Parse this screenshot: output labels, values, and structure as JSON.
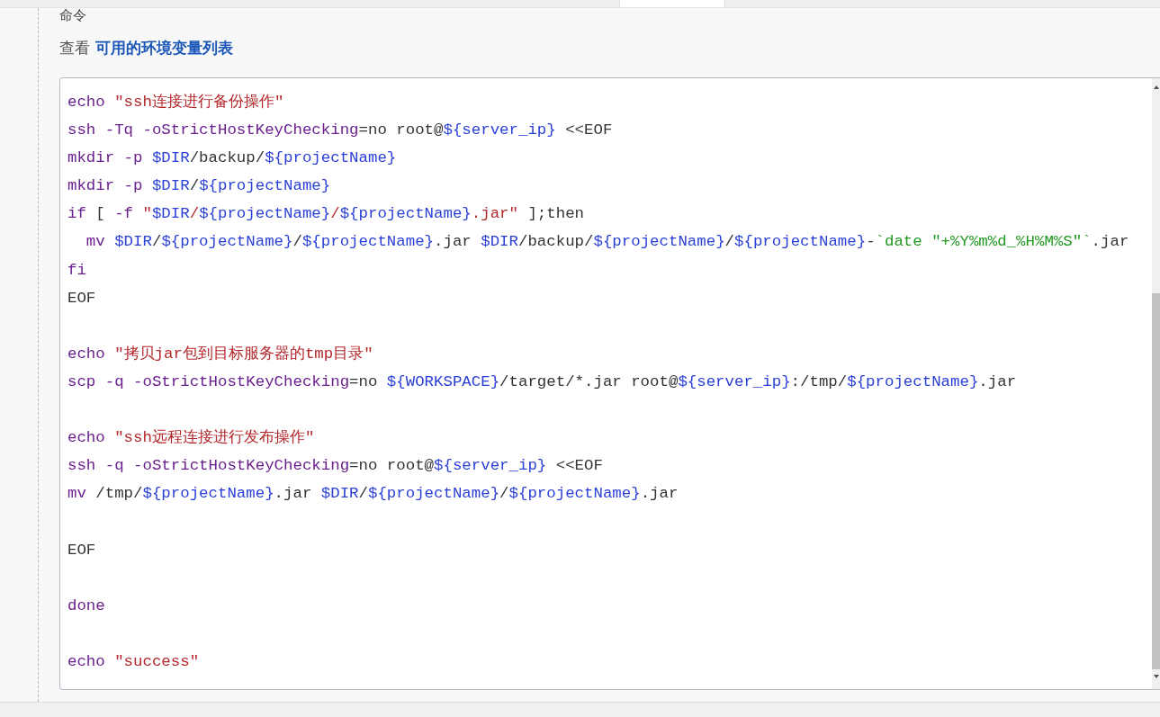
{
  "section_label": "命令",
  "hint": {
    "prefix": "查看",
    "link": "可用的环境变量列表"
  },
  "editor": {
    "lines": [
      {
        "kind": "code",
        "tokens": [
          {
            "kind": "kw",
            "t": "echo "
          },
          {
            "kind": "str",
            "t": "\"ssh连接进行备份操作\""
          }
        ]
      },
      {
        "kind": "code",
        "tokens": [
          {
            "kind": "kw",
            "t": "ssh -Tq -oStrictHostKeyChecking"
          },
          {
            "kind": "plain",
            "t": "=no root@"
          },
          {
            "kind": "var",
            "t": "${server_ip}"
          },
          {
            "kind": "plain",
            "t": " <<EOF"
          }
        ]
      },
      {
        "kind": "code",
        "tokens": [
          {
            "kind": "kw",
            "t": "mkdir -p "
          },
          {
            "kind": "var",
            "t": "$DIR"
          },
          {
            "kind": "plain",
            "t": "/backup/"
          },
          {
            "kind": "var",
            "t": "${projectName}"
          }
        ]
      },
      {
        "kind": "code",
        "tokens": [
          {
            "kind": "kw",
            "t": "mkdir -p "
          },
          {
            "kind": "var",
            "t": "$DIR"
          },
          {
            "kind": "plain",
            "t": "/"
          },
          {
            "kind": "var",
            "t": "${projectName}"
          }
        ]
      },
      {
        "kind": "code",
        "tokens": [
          {
            "kind": "kw",
            "t": "if"
          },
          {
            "kind": "plain",
            "t": " [ "
          },
          {
            "kind": "kw",
            "t": "-f "
          },
          {
            "kind": "str",
            "t": "\""
          },
          {
            "kind": "var",
            "t": "$DIR"
          },
          {
            "kind": "str",
            "t": "/"
          },
          {
            "kind": "var",
            "t": "${projectName}"
          },
          {
            "kind": "str",
            "t": "/"
          },
          {
            "kind": "var",
            "t": "${projectName}"
          },
          {
            "kind": "str",
            "t": ".jar\""
          },
          {
            "kind": "plain",
            "t": " ];then"
          }
        ]
      },
      {
        "kind": "code",
        "tokens": [
          {
            "kind": "kw",
            "t": "  mv "
          },
          {
            "kind": "var",
            "t": "$DIR"
          },
          {
            "kind": "plain",
            "t": "/"
          },
          {
            "kind": "var",
            "t": "${projectName}"
          },
          {
            "kind": "plain",
            "t": "/"
          },
          {
            "kind": "var",
            "t": "${projectName}"
          },
          {
            "kind": "plain",
            "t": ".jar "
          },
          {
            "kind": "var",
            "t": "$DIR"
          },
          {
            "kind": "plain",
            "t": "/backup/"
          },
          {
            "kind": "var",
            "t": "${projectName}"
          },
          {
            "kind": "plain",
            "t": "/"
          },
          {
            "kind": "var",
            "t": "${projectName}"
          },
          {
            "kind": "plain",
            "t": "-"
          },
          {
            "kind": "sub",
            "t": "`date \"+%Y%m%d_%H%M%S\"`"
          },
          {
            "kind": "plain",
            "t": ".jar"
          }
        ]
      },
      {
        "kind": "code",
        "tokens": [
          {
            "kind": "kw",
            "t": "fi"
          }
        ]
      },
      {
        "kind": "code",
        "tokens": [
          {
            "kind": "plain",
            "t": "EOF"
          }
        ]
      },
      {
        "kind": "blank"
      },
      {
        "kind": "code",
        "tokens": [
          {
            "kind": "kw",
            "t": "echo "
          },
          {
            "kind": "str",
            "t": "\"拷贝jar包到目标服务器的tmp目录\""
          }
        ]
      },
      {
        "kind": "code",
        "tokens": [
          {
            "kind": "kw",
            "t": "scp -q -oStrictHostKeyChecking"
          },
          {
            "kind": "plain",
            "t": "=no "
          },
          {
            "kind": "var",
            "t": "${WORKSPACE}"
          },
          {
            "kind": "plain",
            "t": "/target/*.jar root@"
          },
          {
            "kind": "var",
            "t": "${server_ip}"
          },
          {
            "kind": "plain",
            "t": ":/tmp/"
          },
          {
            "kind": "var",
            "t": "${projectName}"
          },
          {
            "kind": "plain",
            "t": ".jar"
          }
        ]
      },
      {
        "kind": "blank"
      },
      {
        "kind": "code",
        "tokens": [
          {
            "kind": "kw",
            "t": "echo "
          },
          {
            "kind": "str",
            "t": "\"ssh远程连接进行发布操作\""
          }
        ]
      },
      {
        "kind": "code",
        "tokens": [
          {
            "kind": "kw",
            "t": "ssh -q -oStrictHostKeyChecking"
          },
          {
            "kind": "plain",
            "t": "=no root@"
          },
          {
            "kind": "var",
            "t": "${server_ip}"
          },
          {
            "kind": "plain",
            "t": " <<EOF"
          }
        ]
      },
      {
        "kind": "code",
        "tokens": [
          {
            "kind": "kw",
            "t": "mv"
          },
          {
            "kind": "plain",
            "t": " /tmp/"
          },
          {
            "kind": "var",
            "t": "${projectName}"
          },
          {
            "kind": "plain",
            "t": ".jar "
          },
          {
            "kind": "var",
            "t": "$DIR"
          },
          {
            "kind": "plain",
            "t": "/"
          },
          {
            "kind": "var",
            "t": "${projectName}"
          },
          {
            "kind": "plain",
            "t": "/"
          },
          {
            "kind": "var",
            "t": "${projectName}"
          },
          {
            "kind": "plain",
            "t": ".jar"
          }
        ]
      },
      {
        "kind": "blank"
      },
      {
        "kind": "code",
        "tokens": [
          {
            "kind": "plain",
            "t": "EOF"
          }
        ]
      },
      {
        "kind": "blank"
      },
      {
        "kind": "code",
        "tokens": [
          {
            "kind": "kw",
            "t": "done"
          }
        ]
      },
      {
        "kind": "blank"
      },
      {
        "kind": "code",
        "tokens": [
          {
            "kind": "kw",
            "t": "echo "
          },
          {
            "kind": "str",
            "t": "\"success\""
          }
        ]
      }
    ]
  }
}
